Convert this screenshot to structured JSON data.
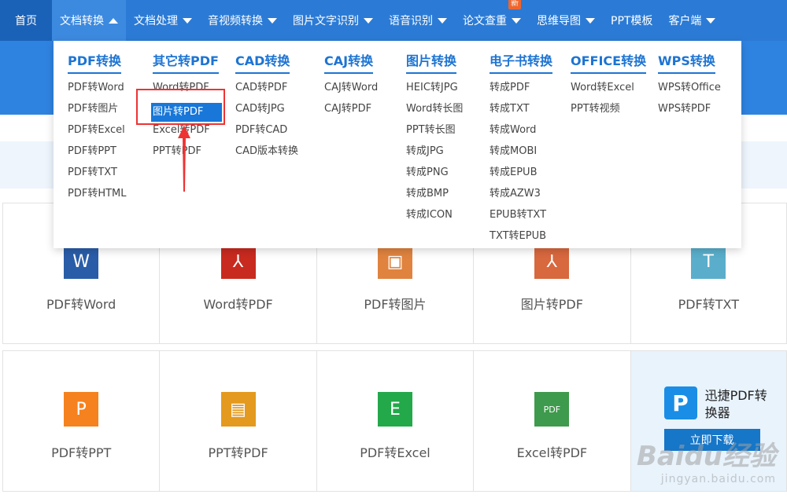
{
  "nav": {
    "items": [
      {
        "label": "首页",
        "caret": "",
        "badge": ""
      },
      {
        "label": "文档转换",
        "caret": "up",
        "badge": ""
      },
      {
        "label": "文档处理",
        "caret": "down",
        "badge": ""
      },
      {
        "label": "音视频转换",
        "caret": "down",
        "badge": ""
      },
      {
        "label": "图片文字识别",
        "caret": "down",
        "badge": ""
      },
      {
        "label": "语音识别",
        "caret": "down",
        "badge": ""
      },
      {
        "label": "论文查重",
        "caret": "down",
        "badge": "新"
      },
      {
        "label": "思维导图",
        "caret": "down",
        "badge": ""
      },
      {
        "label": "PPT模板",
        "caret": "",
        "badge": ""
      },
      {
        "label": "客户端",
        "caret": "down",
        "badge": ""
      }
    ]
  },
  "dropdown": {
    "columns": [
      {
        "title": "PDF转换",
        "items": [
          "PDF转Word",
          "PDF转图片",
          "PDF转Excel",
          "PDF转PPT",
          "PDF转TXT",
          "PDF转HTML"
        ]
      },
      {
        "title": "其它转PDF",
        "items": [
          "Word转PDF",
          "图片转PDF",
          "Excel转PDF",
          "PPT转PDF"
        ]
      },
      {
        "title": "CAD转换",
        "items": [
          "CAD转PDF",
          "CAD转JPG",
          "PDF转CAD",
          "CAD版本转换"
        ]
      },
      {
        "title": "CAJ转换",
        "items": [
          "CAJ转Word",
          "CAJ转PDF"
        ]
      },
      {
        "title": "图片转换",
        "items": [
          "HEIC转JPG",
          "Word转长图",
          "PPT转长图",
          "转成JPG",
          "转成PNG",
          "转成BMP",
          "转成ICON"
        ]
      },
      {
        "title": "电子书转换",
        "items": [
          "转成PDF",
          "转成TXT",
          "转成Word",
          "转成MOBI",
          "转成EPUB",
          "转成AZW3",
          "EPUB转TXT",
          "TXT转EPUB"
        ]
      },
      {
        "title": "OFFICE转换",
        "items": [
          "Word转Excel",
          "PPT转视频"
        ]
      },
      {
        "title": "WPS转换",
        "items": [
          "WPS转Office",
          "WPS转PDF"
        ]
      }
    ],
    "selected": "图片转PDF"
  },
  "tiles": {
    "row1": [
      {
        "label": "PDF转Word",
        "glyph": "W",
        "color": "#2a5da8",
        "icon": "word-icon"
      },
      {
        "label": "Word转PDF",
        "glyph": "⅄",
        "color": "#c92a1f",
        "icon": "pdf-icon"
      },
      {
        "label": "PDF转图片",
        "glyph": "▣",
        "color": "#e0833f",
        "icon": "image-icon"
      },
      {
        "label": "图片转PDF",
        "glyph": "⅄",
        "color": "#d8683e",
        "icon": "pdf-icon"
      },
      {
        "label": "PDF转TXT",
        "glyph": "T",
        "color": "#5aaecb",
        "icon": "txt-icon"
      }
    ],
    "row2": [
      {
        "label": "PDF转PPT",
        "glyph": "P",
        "color": "#f5821f",
        "icon": "ppt-icon"
      },
      {
        "label": "PPT转PDF",
        "glyph": "▤",
        "color": "#e49a1e",
        "icon": "ppt-pdf-icon"
      },
      {
        "label": "PDF转Excel",
        "glyph": "E",
        "color": "#23a84a",
        "icon": "excel-icon"
      },
      {
        "label": "Excel转PDF",
        "glyph": "PDF",
        "color": "#3e9a4c",
        "icon": "excel-pdf-icon"
      }
    ]
  },
  "promo": {
    "title": "迅捷PDF转换器",
    "logo_glyph": "P",
    "button": "立即下载"
  },
  "watermark": {
    "main": "Baidu经验",
    "sub": "jingyan.baidu.com"
  }
}
